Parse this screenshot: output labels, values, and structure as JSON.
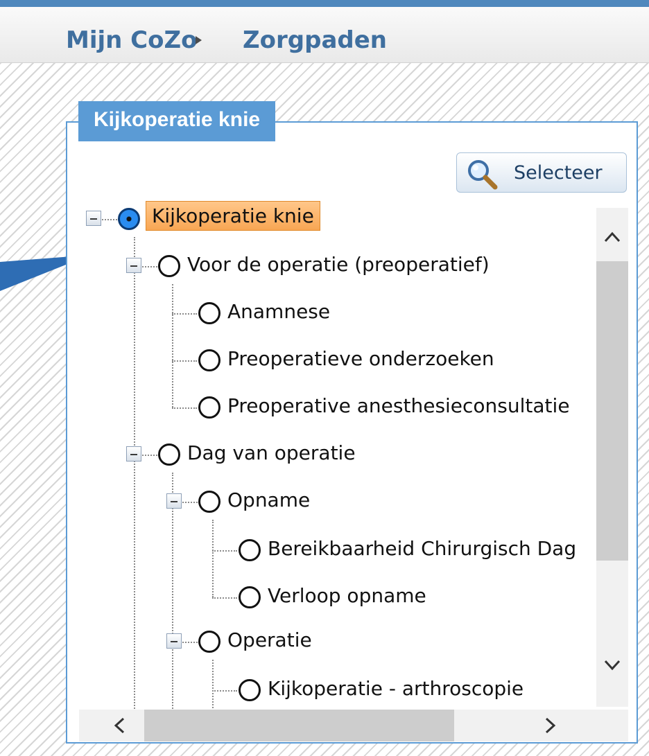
{
  "breadcrumb": {
    "home": "Mijn CoZo",
    "current": "Zorgpaden"
  },
  "panel": {
    "title": "Kijkoperatie knie",
    "select_label": "Selecteer"
  },
  "tree": {
    "root": "Kijkoperatie knie",
    "n1": "Voor de operatie (preoperatief)",
    "n1a": "Anamnese",
    "n1b": "Preoperatieve onderzoeken",
    "n1c": "Preoperative anesthesieconsultatie",
    "n2": "Dag van operatie",
    "n2a": "Opname",
    "n2a1": "Bereikbaarheid Chirurgisch Dag",
    "n2a2": "Verloop opname",
    "n2b": "Operatie",
    "n2b1": "Kijkoperatie - arthroscopie"
  },
  "colors": {
    "accent": "#5b9bd5",
    "selected_bg": "#f8a653",
    "link": "#3f6f9f"
  },
  "icons": [
    "chevron-right-icon",
    "search-icon",
    "collapse-icon",
    "radio-icon",
    "chevron-up-icon",
    "chevron-down-icon",
    "chevron-left-icon"
  ]
}
